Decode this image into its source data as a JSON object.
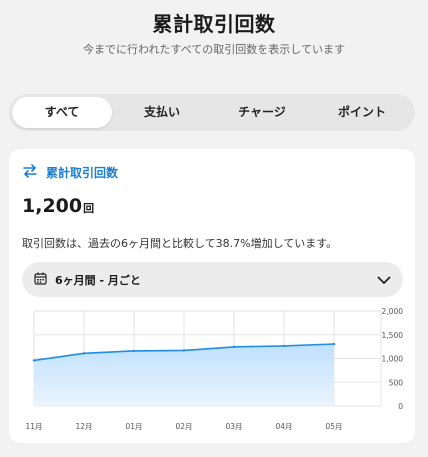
{
  "header": {
    "title": "累計取引回数",
    "subtitle": "今までに行われたすべての取引回数を表示しています"
  },
  "tabs": [
    {
      "label": "すべて",
      "active": true
    },
    {
      "label": "支払い",
      "active": false
    },
    {
      "label": "チャージ",
      "active": false
    },
    {
      "label": "ポイント",
      "active": false
    }
  ],
  "card": {
    "title": "累計取引回数",
    "title_icon": "swap-arrows-icon",
    "total": "1,200",
    "total_unit": "回",
    "comparison": "取引回数は、過去の6ヶ月間と比較して38.7%増加しています。",
    "period_select": {
      "value": "6ヶ月間 - 月ごと",
      "icon": "calendar-icon",
      "chevron_icon": "chevron-down-icon"
    }
  },
  "colors": {
    "accent": "#1a7fd4",
    "line": "#1f8de6",
    "area_top": "#bfe0fb",
    "area_bottom": "#eaf5fe"
  },
  "chart_data": {
    "type": "area",
    "x": [
      "11月",
      "12月",
      "01月",
      "02月",
      "03月",
      "04月",
      "05月"
    ],
    "values": [
      960,
      1110,
      1160,
      1170,
      1245,
      1265,
      1305
    ],
    "ylim": [
      0,
      2000
    ],
    "yticks": [
      "2,000",
      "1,500",
      "1,000",
      "500",
      "0"
    ],
    "ytick_values": [
      2000,
      1500,
      1000,
      500,
      0
    ],
    "grid": true,
    "y_axis_side": "right"
  }
}
